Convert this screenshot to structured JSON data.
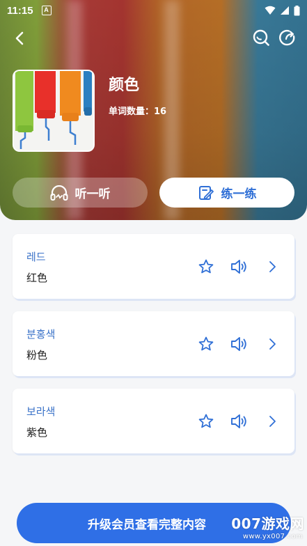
{
  "status_bar": {
    "time": "11:15",
    "notification_letter": "A"
  },
  "header": {
    "book_title": "颜色",
    "word_count_label": "单词数量：16",
    "listen_button": "听一听",
    "practice_button": "练一练"
  },
  "words": [
    {
      "korean": "레드",
      "chinese": "红色"
    },
    {
      "korean": "분홍색",
      "chinese": "粉色"
    },
    {
      "korean": "보라색",
      "chinese": "紫色"
    }
  ],
  "upgrade_button": "升级会员查看完整内容",
  "watermark": {
    "text": "007游戏网",
    "url": "www.yx007.com"
  },
  "colors": {
    "accent": "#2f6fe6",
    "korean_text": "#3a72c8"
  }
}
